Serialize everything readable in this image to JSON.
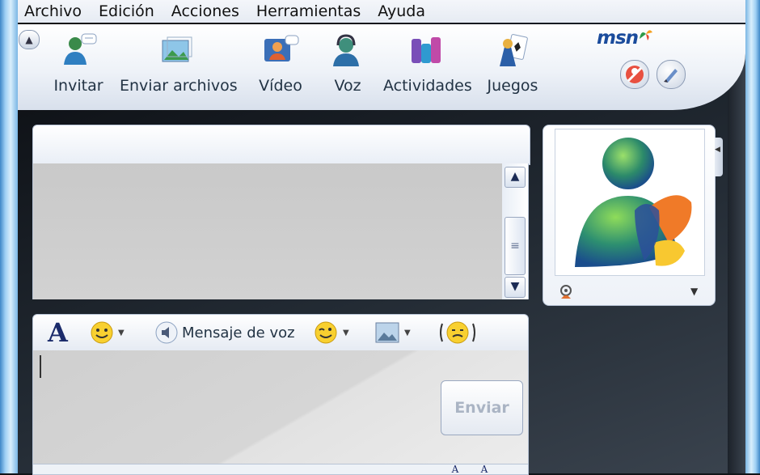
{
  "menu": [
    "Archivo",
    "Edición",
    "Acciones",
    "Herramientas",
    "Ayuda"
  ],
  "toolbar": {
    "buttons": [
      {
        "label": "Invitar",
        "icon": "invite-contact-icon"
      },
      {
        "label": "Enviar archivos",
        "icon": "send-files-icon"
      },
      {
        "label": "Vídeo",
        "icon": "video-call-icon"
      },
      {
        "label": "Voz",
        "icon": "voice-call-icon"
      },
      {
        "label": "Actividades",
        "icon": "activities-icon"
      },
      {
        "label": "Juegos",
        "icon": "games-icon"
      }
    ],
    "logo": "msn"
  },
  "compose": {
    "voice_clip_label": "Mensaje de voz",
    "send_label": "Enviar"
  },
  "colors": {
    "frame_blue": "#7ab6e4",
    "toolbar_text": "#223344",
    "msn_blue": "#1a4b9c"
  }
}
